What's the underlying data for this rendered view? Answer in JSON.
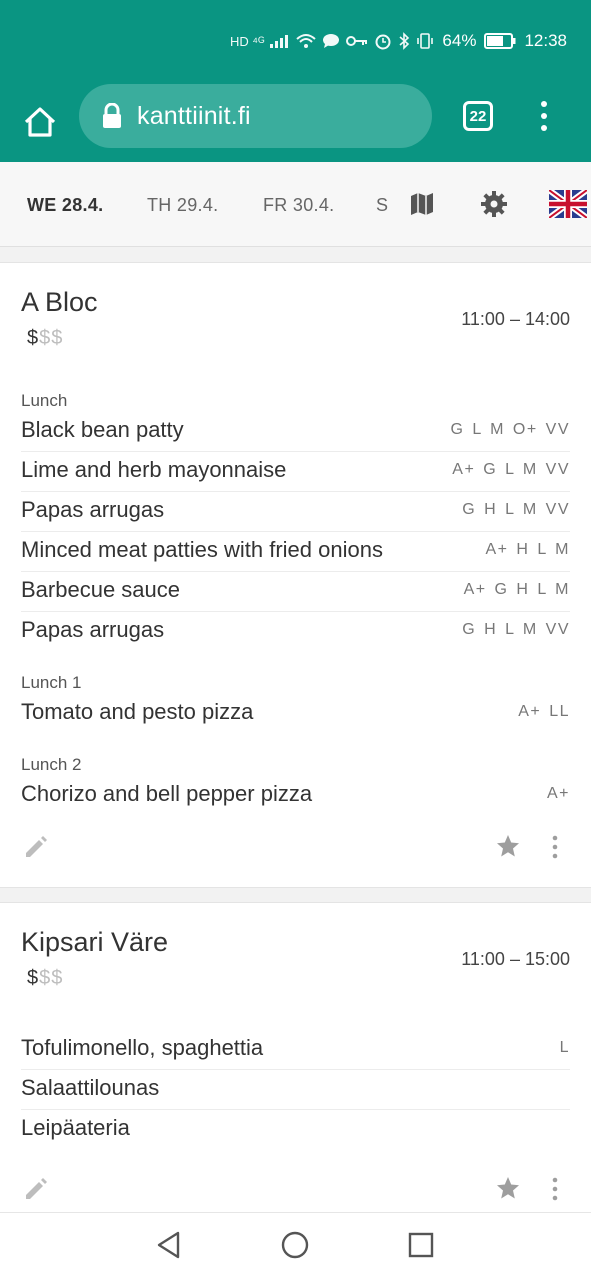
{
  "status": {
    "icons_text": "HD ⁴ᴳ",
    "battery": "64%",
    "time": "12:38"
  },
  "browser": {
    "url": "kanttiinit.fi",
    "tab_count": "22"
  },
  "days": [
    "WE 28.4.",
    "TH 29.4.",
    "FR 30.4.",
    "S"
  ],
  "restaurants": [
    {
      "name": "A Bloc",
      "price_on": "$",
      "price_off": "$$",
      "hours": "11:00 – 14:00",
      "sections": [
        {
          "label": "Lunch",
          "items": [
            {
              "dish": "Black bean patty",
              "tags": "G L M O+ VV"
            },
            {
              "dish": "Lime and herb mayonnaise",
              "tags": "A+ G L M VV"
            },
            {
              "dish": "Papas arrugas",
              "tags": "G H L M VV"
            },
            {
              "dish": "Minced meat patties with fried onions",
              "tags": "A+ H L M"
            },
            {
              "dish": "Barbecue sauce",
              "tags": "A+ G H L M"
            },
            {
              "dish": "Papas arrugas",
              "tags": "G H L M VV"
            }
          ]
        },
        {
          "label": "Lunch 1",
          "items": [
            {
              "dish": "Tomato and pesto pizza",
              "tags": "A+ LL"
            }
          ]
        },
        {
          "label": "Lunch 2",
          "items": [
            {
              "dish": "Chorizo and bell pepper pizza",
              "tags": "A+"
            }
          ]
        }
      ]
    },
    {
      "name": "Kipsari Väre",
      "price_on": "$",
      "price_off": "$$",
      "hours": "11:00 – 15:00",
      "items": [
        {
          "dish": "Tofulimonello, spaghettia",
          "tags": "L"
        },
        {
          "dish": "Salaattilounas",
          "tags": ""
        },
        {
          "dish": "Leipäateria",
          "tags": ""
        }
      ]
    }
  ]
}
